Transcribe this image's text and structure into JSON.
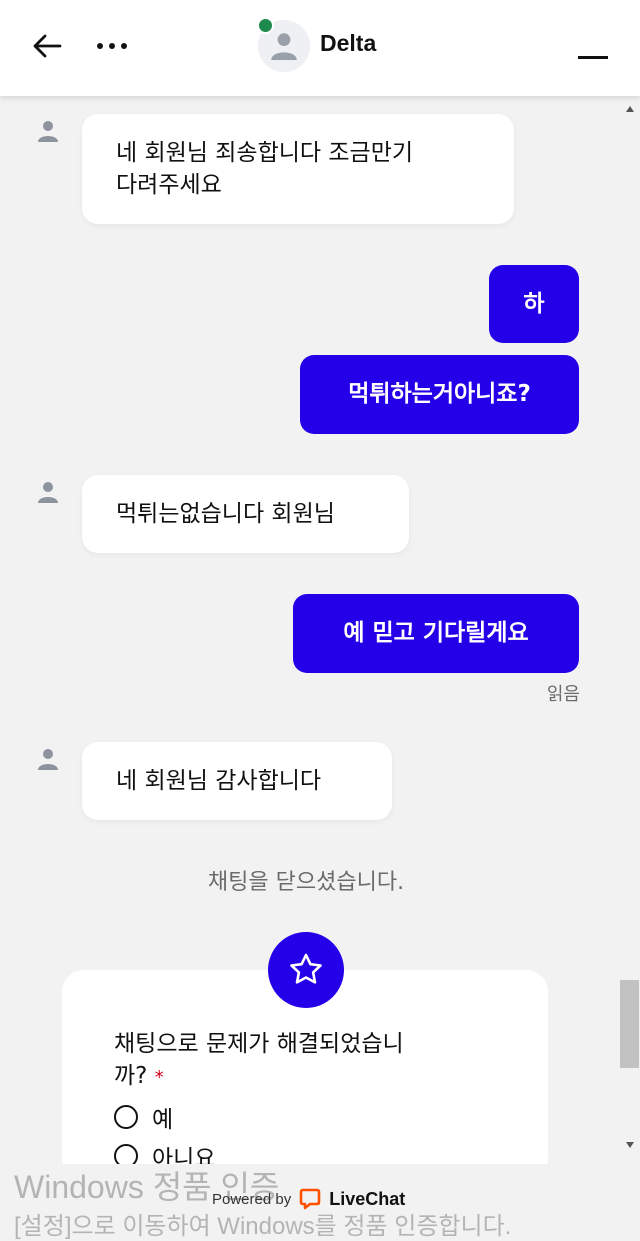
{
  "header": {
    "agent_name": "Delta",
    "status_color": "#1e8a4c"
  },
  "messages": [
    {
      "from": "agent",
      "text": "네 회원님 죄송합니다 조금만기\n다려주세요"
    },
    {
      "from": "visitor",
      "text": "하"
    },
    {
      "from": "visitor",
      "text": "먹튀하는거아니죠?"
    },
    {
      "from": "agent",
      "text": "먹튀는없습니다 회원님"
    },
    {
      "from": "visitor",
      "text": "예 믿고 기다릴게요"
    },
    {
      "from": "agent",
      "text": "네 회원님 감사합니다"
    }
  ],
  "read_receipt": "읽음",
  "system_message": "채팅을 닫으셨습니다.",
  "survey": {
    "question": "채팅으로 문제가 해결되었습니\n까?",
    "required_mark": "*",
    "options": [
      "예",
      "아니요"
    ]
  },
  "footer": {
    "powered_by": "Powered by",
    "brand": "LiveChat",
    "brand_color": "#ff5100"
  },
  "watermark": {
    "line1": "Windows 정품 인증",
    "line2": "[설정]으로 이동하여 Windows를 정품 인증합니다."
  },
  "accent_color": "#2400e8",
  "icons": [
    "back-arrow-icon",
    "more-icon",
    "person-icon",
    "minimize-icon",
    "star-icon",
    "livechat-logo-icon"
  ]
}
